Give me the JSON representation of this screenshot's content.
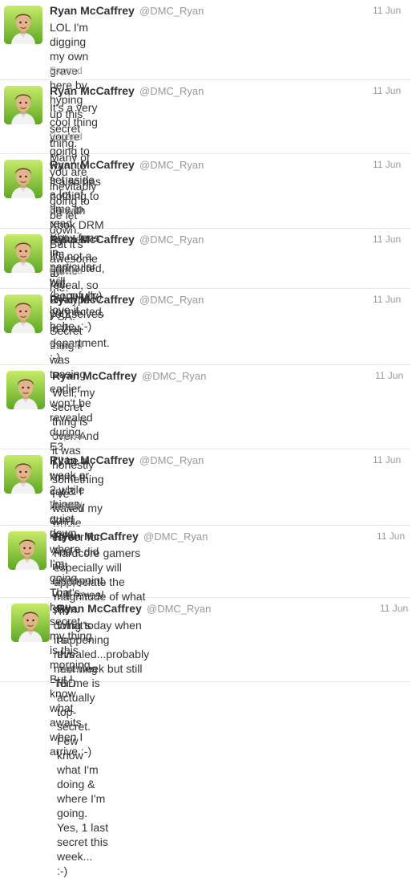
{
  "tweets": [
    {
      "name": "Ryan McCaffrey",
      "handle": "@DMC_Ryan",
      "date": "11 Jun",
      "lines": [
        "LOL I'm digging my own grave here by hyping up this secret thing.",
        "Many of you are inevitably going to be let down. But it's awesome to",
        "me!"
      ],
      "expand": "Expand"
    },
    {
      "name": "Ryan McCaffrey",
      "handle": "@DMC_Ryan",
      "date": "11 Jun",
      "lines": [
        "It's a very cool thing you're going to want to set aside a lot of time to",
        "read. Xbox fans in particular will (hopefully) love it."
      ],
      "expand": "Expand"
    },
    {
      "name": "Ryan McCaffrey",
      "handle": "@DMC_Ryan",
      "date": "11 Jun",
      "lines": [
        "It also has nothing to do with Xbox DRM policies. I'm connected, but",
        "not THAT connected, hehe. :-)"
      ],
      "expand": "Expand"
    },
    {
      "name": "Ryan McCaffrey",
      "handle": "@DMC_Ryan",
      "date": "11 Jun",
      "lines": [
        "It's not a game reveal, so un-hype yourselves in that department. :-)"
      ],
      "expand": "Expand"
    },
    {
      "name": "Ryan McCaffrey",
      "handle": "@DMC_Ryan",
      "date": "11 Jun",
      "lines": [
        "PSA: Secret thing I was teasing earlier won't be revealed during E3.",
        "It'll be a week or 2 while things quiet down."
      ],
      "expand": "Expand"
    },
    {
      "name": "Ryan McCaffrey",
      "handle": "@DMC_Ryan",
      "date": "11 Jun",
      "lines": [
        "Well, my secret thing is over. And it was honestly something I've",
        "waited my whole career for. And it did not disappoint. Will reveal",
        "soon."
      ],
      "expand": "Expand"
    },
    {
      "name": "Ryan McCaffrey",
      "handle": "@DMC_Ryan",
      "date": "11 Jun",
      "lines": [
        "I'm in a car & I literally don't know where I'm going. That's how secret",
        "my thing is this morning. But I know what awaits when I arrive :-)"
      ],
      "expand": "Expand"
    },
    {
      "name": "Ryan McCaffrey",
      "handle": "@DMC_Ryan",
      "date": "11 Jun",
      "lines": [
        "Hardcore gamers especially will appreciate the magnitude of what I'm",
        "doing today when it's revealed...probably next week but still TBD."
      ],
      "expand": "Expand"
    },
    {
      "name": "Ryan McCaffrey",
      "handle": "@DMC_Ryan",
      "date": "11 Jun",
      "lines": [
        "What's happening this morning for me is actually top-secret. Few",
        "know what I'm doing & where I'm going. Yes, 1 last secret this week...",
        ":-)"
      ],
      "expand": "Expand"
    }
  ]
}
